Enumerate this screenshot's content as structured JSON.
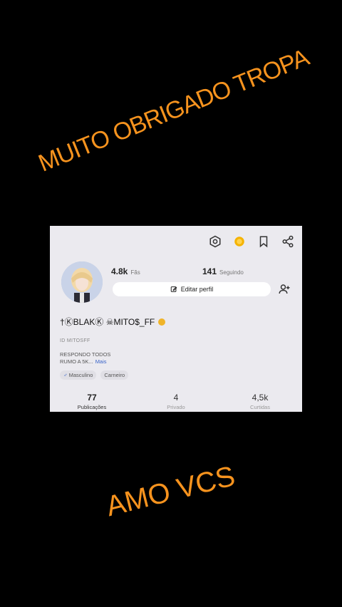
{
  "captions": {
    "top": "MUITO OBRIGADO TROPA",
    "bottom": "AMO VCS"
  },
  "colors": {
    "caption": "#f7931e",
    "card_bg": "#ebeaef",
    "accent": "#3a64c8"
  },
  "toolbar": {
    "icons": [
      "settings-icon",
      "coin-icon",
      "bookmark-icon",
      "share-icon"
    ]
  },
  "profile": {
    "fans_count": "4.8k",
    "fans_label": "Fãs",
    "following_count": "141",
    "following_label": "Seguindo",
    "edit_label": "Editar perfil",
    "username": "†ⓀBLAKⓀ ☠MITO$_FF",
    "user_id": "ID MITOSFF",
    "bio_line1": "RESPONDO TODOS",
    "bio_line2": "RUMO A 5K...",
    "more_label": "Mais",
    "tag_gender": "Masculino",
    "tag_sign": "Carneiro"
  },
  "stats": [
    {
      "value": "77",
      "label": "Publicações"
    },
    {
      "value": "4",
      "label": "Privado"
    },
    {
      "value": "4,5k",
      "label": "Curtidas"
    }
  ]
}
